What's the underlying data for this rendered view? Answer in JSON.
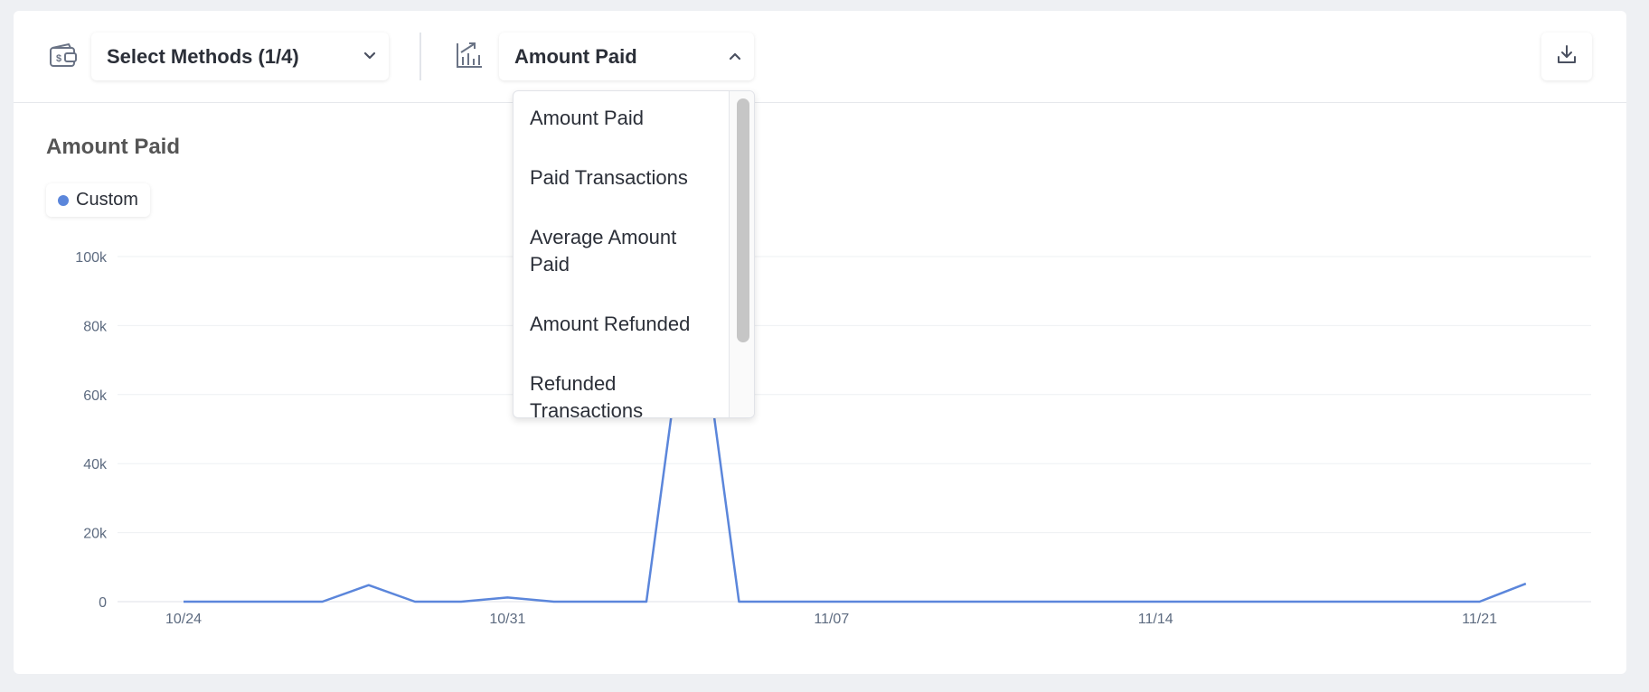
{
  "toolbar": {
    "methods_label": "Select Methods (1/4)",
    "metric_label": "Amount Paid",
    "icons": {
      "wallet": "wallet-dollar-icon",
      "chart": "chart-trend-icon",
      "chevron_methods": "chevron-down-icon",
      "chevron_metric": "chevron-up-icon",
      "download": "download-icon"
    }
  },
  "dropdown": {
    "options": [
      "Amount Paid",
      "Paid Transactions",
      "Average Amount Paid",
      "Amount Refunded",
      "Refunded Transactions"
    ]
  },
  "chart": {
    "title": "Amount Paid",
    "legend": [
      {
        "name": "Custom",
        "color": "#5b86db"
      }
    ]
  },
  "chart_data": {
    "type": "line",
    "title": "Amount Paid",
    "xlabel": "",
    "ylabel": "",
    "ylim": [
      0,
      100000
    ],
    "y_ticks": [
      "0",
      "20k",
      "40k",
      "60k",
      "80k",
      "100k"
    ],
    "y_tick_values": [
      0,
      20000,
      40000,
      60000,
      80000,
      100000
    ],
    "x_ticks": [
      "10/24",
      "10/31",
      "11/07",
      "11/14",
      "11/21"
    ],
    "x_tick_dates": [
      "2023-10-24",
      "2023-10-31",
      "2023-11-07",
      "2023-11-14",
      "2023-11-21"
    ],
    "grid": true,
    "legend_position": "top-left",
    "series": [
      {
        "name": "Custom",
        "color": "#5b86db",
        "x": [
          "2023-10-24",
          "2023-10-25",
          "2023-10-26",
          "2023-10-27",
          "2023-10-28",
          "2023-10-29",
          "2023-10-30",
          "2023-10-31",
          "2023-11-01",
          "2023-11-02",
          "2023-11-03",
          "2023-11-04",
          "2023-11-05",
          "2023-11-06",
          "2023-11-07",
          "2023-11-08",
          "2023-11-09",
          "2023-11-10",
          "2023-11-11",
          "2023-11-12",
          "2023-11-13",
          "2023-11-14",
          "2023-11-15",
          "2023-11-16",
          "2023-11-17",
          "2023-11-18",
          "2023-11-19",
          "2023-11-20",
          "2023-11-21",
          "2023-11-22"
        ],
        "values": [
          0,
          0,
          0,
          0,
          4800,
          0,
          0,
          1200,
          0,
          0,
          0,
          100000,
          0,
          0,
          0,
          0,
          0,
          0,
          0,
          0,
          0,
          0,
          0,
          0,
          0,
          0,
          0,
          0,
          0,
          5200
        ]
      }
    ]
  }
}
